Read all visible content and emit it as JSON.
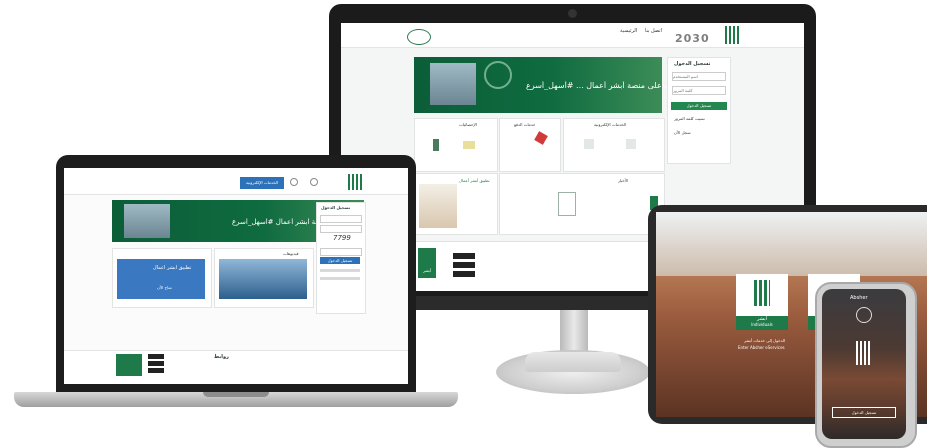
{
  "monitor": {
    "logo_year": "2030",
    "header_links": [
      "ﺍﻟﺮﺋﻴﺴﻴﺔ",
      "ﺍﺗﺼﻞ ﺑﻨﺎ"
    ],
    "banner_text": "ﺧﺪﻣﺎﺗﻚ ﻋﻠﻰ ﻣﻨﺼﺔ ﺃﺑﺸﺮ ﺃﻋﻤﺎﻝ ... #ﺃﺳﻬﻞ_ﺃﺳﺮﻉ",
    "login": {
      "title": "ﺗﺴﺠﻴﻞ ﺍﻟﺪﺧﻮﻝ",
      "username_placeholder": "ﺍﺳﻢ ﺍﻟﻤﺴﺘﺨﺪﻡ",
      "password_placeholder": "ﻛﻠﻤﺔ ﺍﻟﻤﺮﻭﺭ",
      "submit_label": "ﺗﺴﺠﻴﻞ ﺍﻟﺪﺧﻮﻝ",
      "links": [
        "ﻧﺴﻴﺖ ﻛﻠﻤﺔ ﺍﻟﻤﺮﻭﺭ",
        "ﺳﺠﻞ ﺍﻵﻥ"
      ]
    },
    "sections": [
      "ﺍﻟﺨﺪﻣﺎﺕ ﺍﻹﻟﻜﺘﺮﻭﻧﻴﺔ",
      "ﺧﺪﻣﺎﺕ ﺍﻟﺪﻓﻊ",
      "ﺍﻹﺣﺼﺎﺋﻴﺎﺕ"
    ],
    "news_title": "ﺍﻷﺧﺒﺎﺭ",
    "promo_title": "ﺗﻄﺒﻴﻖ ﺃﺑﺸﺮ ﺃﻋﻤﺎﻝ",
    "footer_brand": "ﺃﺑﺸﺮ"
  },
  "laptop": {
    "nav_button": "ﺍﻟﺨﺪﻣﺎﺕ ﺍﻹﻟﻜﺘﺮﻭﻧﻴﺔ",
    "banner_text": "ﺧﺪﻣﺎﺗﻚ ﻋﻠﻰ ﻣﻨﺼﺔ ﺃﺑﺸﺮ ﺃﻋﻤﺎﻝ #ﺃﺳﻬﻞ_ﺃﺳﺮﻉ",
    "login_title": "ﺗﺴﺠﻴﻞ ﺍﻟﺪﺧﻮﻝ",
    "captcha": "7799",
    "submit_label": "ﺗﺴﺠﻴﻞ ﺍﻟﺪﺧﻮﻝ",
    "promo_title": "ﺗﻄﺒﻴﻖ ﺃﺑﺸﺮ ﺃﻋﻤﺎﻝ",
    "promo_sub": "ﻣﺘﺎﺡ ﺍﻵﻥ",
    "videos_title": "ﻓﻴﺪﻳﻮﻫﺎﺕ",
    "footer_title": "ﺭﻭﺍﺑﻂ",
    "store_badges": [
      "App Store",
      "Google Play",
      "AppGallery"
    ]
  },
  "tablet": {
    "app_name": "ﺃﺑﺸﺮ",
    "app_sub": "Individuals",
    "caption": "Enter Absher eServices",
    "caption_ar": "ﺍﻟﺪﺧﻮﻝ ﺇﻟﻰ ﺧﺪﻣﺎﺕ ﺃﺑﺸﺮ"
  },
  "phone": {
    "top_label": "Absher",
    "login_button": "ﺗﺴﺠﻴﻞ ﺍﻟﺪﺧﻮﻝ"
  },
  "colors": {
    "brand_green": "#1e7a49",
    "dark_green": "#0b5e38"
  }
}
